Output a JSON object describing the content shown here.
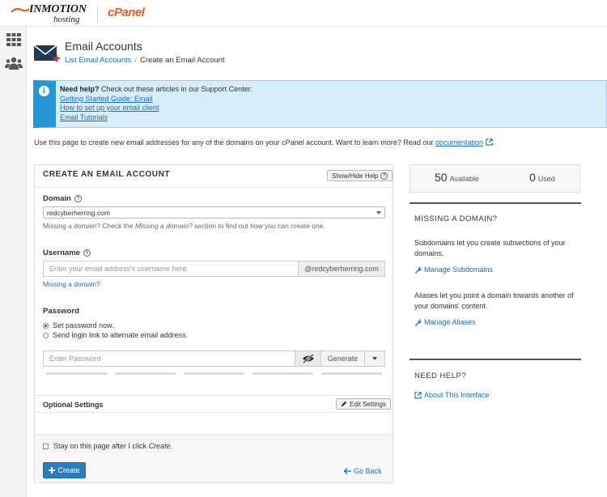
{
  "brand": {
    "hosting_name": "INMOTION",
    "hosting_sub": "hosting",
    "cpanel": "cPanel"
  },
  "rail": {
    "icons": [
      "grid-icon",
      "users-icon"
    ]
  },
  "header": {
    "title": "Email Accounts",
    "breadcrumb": {
      "parent": "List Email Accounts",
      "current": "Create an Email Account"
    }
  },
  "help": {
    "lead": "Need help?",
    "text": " Check out these articles in our Support Center:",
    "links": [
      "Getting Started Guide: Email",
      "How to set up your email client",
      "Email Tutorials"
    ]
  },
  "intro": {
    "text": "Use this page to create new email addresses for any of the domains on your cPanel account. Want to learn more? Read our ",
    "link": "documentation",
    "suffix": "."
  },
  "form": {
    "title": "CREATE AN EMAIL ACCOUNT",
    "show_hide_help": "Show/Hide Help",
    "domain_label": "Domain",
    "domain_value": "redcyberherring.com",
    "domain_hint_pre": "Missing a domain? Check the ",
    "domain_hint_em": "Missing a domain?",
    "domain_hint_post": " section to find out how you can create one.",
    "username_label": "Username",
    "username_placeholder": "Enter your email address's username here.",
    "username_suffix": "@redcyberherring.com",
    "missing_domain_link": "Missing a domain?",
    "password_label": "Password",
    "radio_set": "Set password now.",
    "radio_send": "Send login link to alternate email address.",
    "password_placeholder": "Enter Password",
    "generate": "Generate",
    "optional_title": "Optional Settings",
    "edit_settings": "Edit Settings",
    "stay_pre": "Stay on this page after I click ",
    "stay_em": "Create",
    "stay_post": ".",
    "create": "Create",
    "go_back": "Go Back"
  },
  "stats": {
    "available_num": "50",
    "available_label": "Available",
    "used_num": "0",
    "used_label": "Used"
  },
  "missing": {
    "title": "MISSING A DOMAIN?",
    "sub_text": "Subdomains let you create subsections of your domains.",
    "sub_link": "Manage Subdomains",
    "alias_text": "Aliases let you point a domain towards another of your domains' content.",
    "alias_link": "Manage Aliases"
  },
  "needhelp": {
    "title": "NEED HELP?",
    "link": "About This Interface"
  },
  "colors": {
    "accent": "#2a7bc0",
    "info": "#2597d4",
    "brand": "#e85c24"
  }
}
